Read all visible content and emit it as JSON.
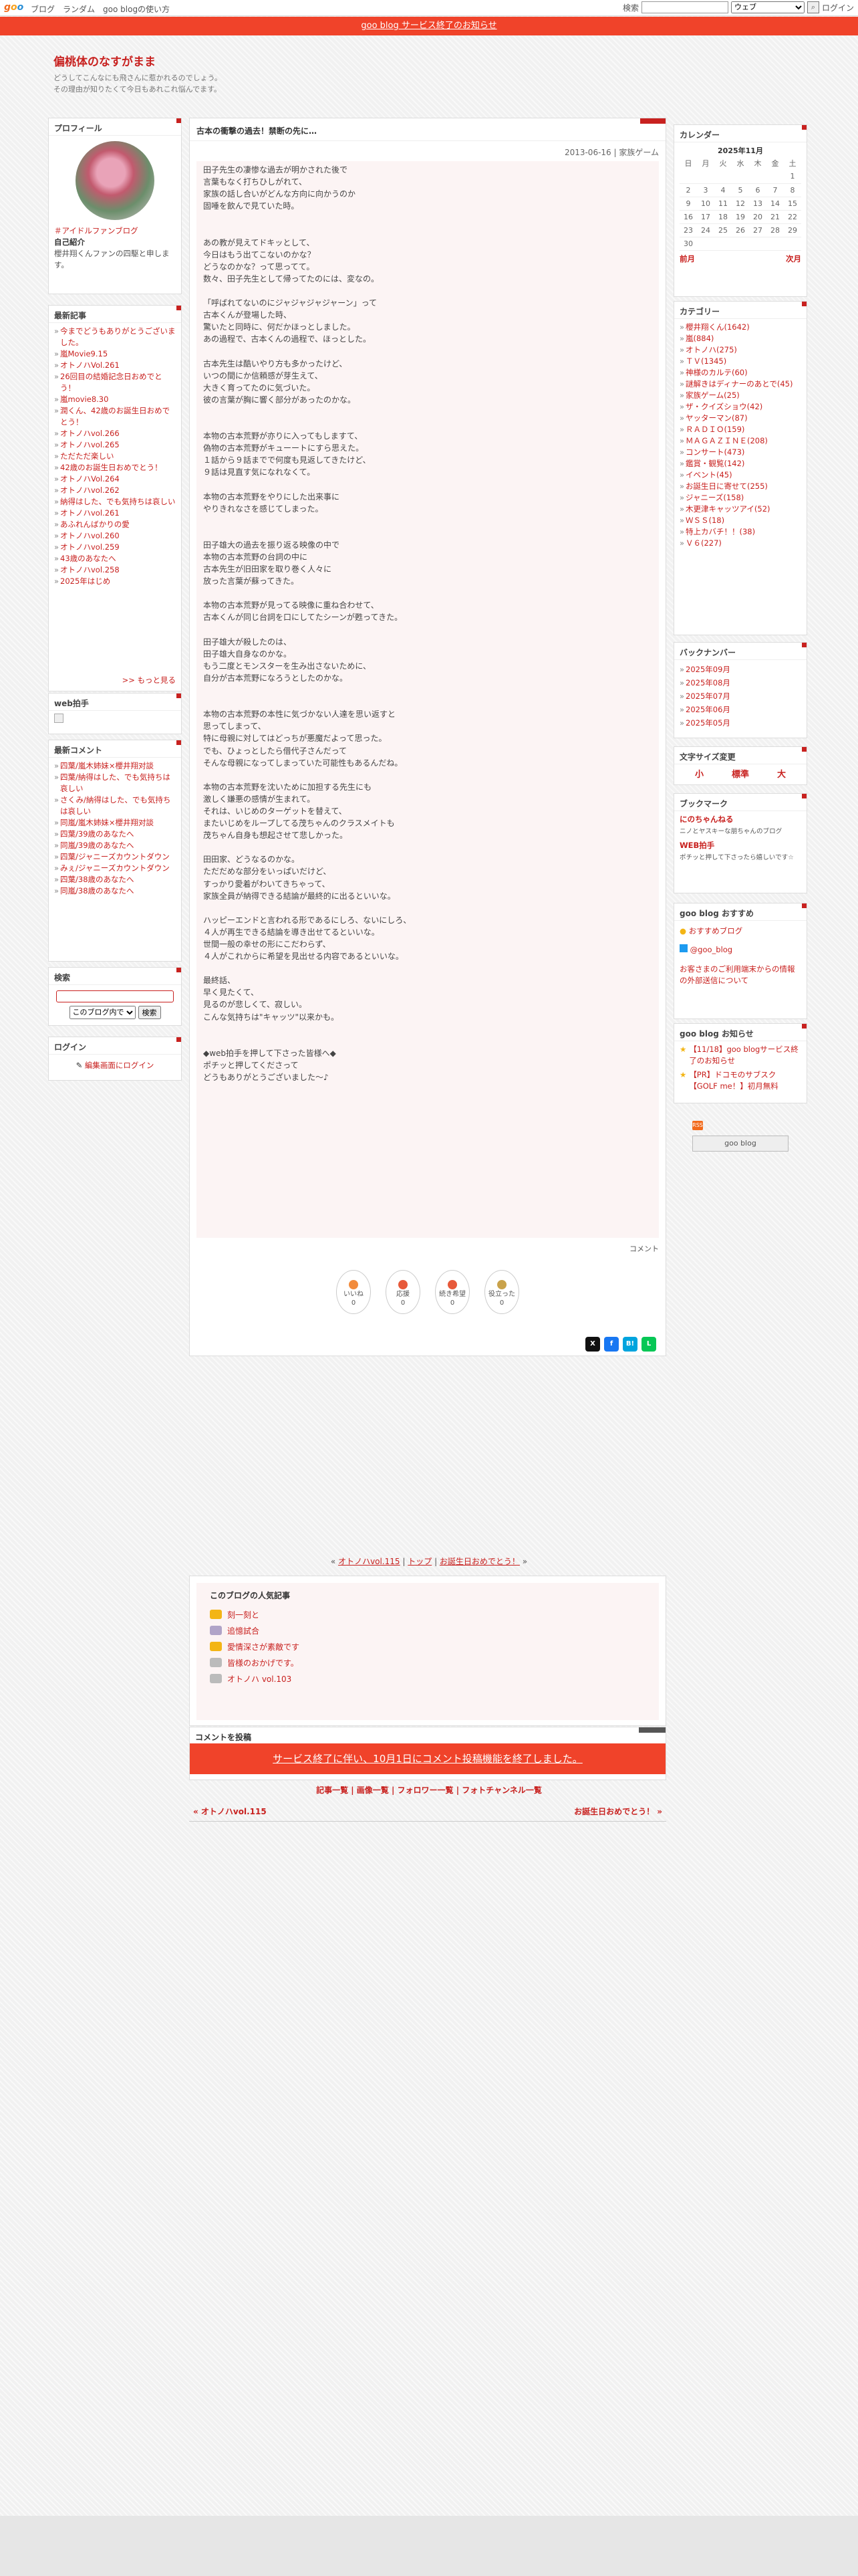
{
  "gbar": {
    "logo": [
      "g",
      "o",
      "o"
    ],
    "links": [
      "ブログ",
      "ランダム",
      "goo blogの使い方"
    ],
    "search_label": "検索",
    "search_select": "ウェブ",
    "login": "ログイン"
  },
  "notice": "goo blog サービス終了のお知らせ",
  "blog": {
    "title": "偏桃体のなすがまま",
    "desc1": "どうしてこんなにも飛さんに惹かれるのでしょう。",
    "desc2": "その理由が知りたくて今日もあれこれ悩んでます。"
  },
  "profile": {
    "heading": "プロフィール",
    "link": "＃アイドルファンブログ",
    "self_label": "自己紹介",
    "self_text": "櫻井翔くんファンの四駆と申します。"
  },
  "recent": {
    "heading": "最新記事",
    "items": [
      "今までどうもありがとうございました。",
      "嵐Movie9.15",
      "オトノハVol.261",
      "26回目の結婚記念日おめでとう！",
      "嵐movie8.30",
      "潤くん、42歳のお誕生日おめでとう！",
      "オトノハvol.266",
      "オトノハvol.265",
      "ただただ楽しい",
      "42歳のお誕生日おめでとう！",
      "オトノハVol.264",
      "オトノハvol.262",
      "納得はした、でも気持ちは哀しい",
      "オトノハvol.261",
      "あふれんばかりの愛",
      "オトノハvol.260",
      "オトノハvol.259",
      "43歳のあなたへ",
      "オトノハvol.258",
      "2025年はじめ"
    ],
    "more": ">> もっと見る"
  },
  "webclap": {
    "heading": "web拍手"
  },
  "comments": {
    "heading": "最新コメント",
    "items": [
      "四葉/嵐木姉妹×櫻井翔对談",
      "四葉/納得はした、でも気持ちは哀しい",
      "さくみ/納得はした、でも気持ちは哀しい",
      "同嵐/嵐木姉妹×櫻井翔对談",
      "四葉/39歳のあなたへ",
      "同嵐/39歳のあなたへ",
      "四葉/ジャニーズカウントダウン",
      "みぇ/ジャニーズカウントダウン",
      "四葉/38歳のあなたへ",
      "同嵐/38歳のあなたへ"
    ]
  },
  "search": {
    "heading": "検索",
    "select": "このブログ内で",
    "button": "検索"
  },
  "login": {
    "heading": "ログイン",
    "link": "編集画面にログイン"
  },
  "article": {
    "title": "古本の衝撃の過去！禁断の先に…",
    "meta": "2013-06-16 | 家族ゲーム",
    "body": "田子先生の凄惨な過去が明かされた後で\n言葉もなく打ちひしがれて、\n家族の話し合いがどんな方向に向かうのか\n固唾を飲んで見ていた時。\n\n\nあの教が見えてドキッとして、\n今日はもう出てこないのかな？\nどうなのかな？って思ってて。\n数々、田子先生として帰ってたのには、変なの。\n\n「呼ばれてないのにジャジャジャジャーン」って\n古本くんが登場した時、\n驚いたと同時に、何だかほっとしました。\nあの過程で、古本くんの過程で、ほっとした。\n\n古本先生は酷いやり方も多かったけど、\nいつの間にか信頼感が芽生えて、\n大きく育ってたのに気づいた。\n彼の言葉が胸に響く部分があったのかな。\n\n\n本物の古本荒野が亦りに入ってもしますて、\n偽物の古本荒野がキューートにすら思えた。\n１話から９話までで何度も見返してきたけど、\n９話は見直す気になれなくて。\n\n本物の古本荒野をやりにした出来事に\nやりきれなさを感じてしまった。\n\n\n田子雄大の過去を振り返る映像の中で\n本物の古本荒野の台詞の中に\n古本先生が旧田家を取り巻く人々に\n放った言葉が蘇ってきた。\n\n本物の古本荒野が見ってる映像に重ね合わせて、\n古本くんが同じ台詞を口にしてたシーンが甦ってきた。\n\n田子雄大が殺したのは、\n田子雄大自身なのかな。\nもう二度とモンスターを生み出さないために、\n自分が古本荒野になろうとしたのかな。\n\n\n本物の古本荒野の本性に気づかない人達を思い返すと\n思ってしまって、\n特に母親に対してはどっちが悪魔だよって思った。\nでも、ひょっとしたら借代子さんだって\nそんな母親になってしまっていた可能性もあるんだね。\n\n本物の古本荒野を沈いために加担する先生にも\n激しく嫌悪の感情が生まれて。\nそれは、いじめのターゲットを替えて、\nまたいじめをループしてる茂ちゃんのクラスメイトも\n茂ちゃん自身も想起させて悲しかった。\n\n田田家、どうなるのかな。\nただだめな部分をいっぱいだけど、\nすっかり愛着がわいてきちゃって、\n家族全員が納得できる結論が最終的に出るといいな。\n\nハッピーエンドと言われる形であるにしろ、ないにしろ、\n４人が再生できる結論を導き出せてるといいな。\n世間一般の幸せの形にこだわらず、\n４人がこれからに希望を見出せる内容であるといいな。\n\n最終話、\n早く見たくて、\n見るのが悲しくて、寂しい。\nこんな気持ちは\"キャッツ\"以来かも。\n\n\n◆web拍手を押して下さった皆様へ◆\nポチッと押してくださって\nどうもありがとうございました〜♪",
    "comment": "コメント",
    "reactions": [
      {
        "en": "いいね",
        "label": "いいね",
        "count": "0",
        "color": "#f28b3c"
      },
      {
        "en": "応援",
        "label": "応援",
        "count": "0",
        "color": "#e7593a"
      },
      {
        "en": "続き希望",
        "label": "続き希望",
        "count": "0",
        "color": "#e7593a"
      },
      {
        "en": "役立った",
        "label": "役立った",
        "count": "0",
        "color": "#c9a24a"
      }
    ],
    "share": [
      {
        "t": "X",
        "c": "#111"
      },
      {
        "t": "f",
        "c": "#1877f2"
      },
      {
        "t": "B!",
        "c": "#00a4de"
      },
      {
        "t": "L",
        "c": "#06c755"
      }
    ]
  },
  "nav": {
    "prev": "オトノハvol.115",
    "top": "トップ",
    "next": "お誕生日おめでとう！"
  },
  "popular": {
    "heading": "このブログの人気記事",
    "items": [
      {
        "t": "刻一刻と",
        "c": "#f3b515"
      },
      {
        "t": "追憶試合",
        "c": "#b0a4c8"
      },
      {
        "t": "愛情深さが素敵です",
        "c": "#f3b515"
      },
      {
        "t": "皆様のおかげです。",
        "c": "#bbb"
      },
      {
        "t": "オトノハ vol.103",
        "c": "#bbb"
      }
    ]
  },
  "post": {
    "heading": "コメントを投稿",
    "bar": "サービス終了に伴い、10月1日にコメント投稿機能を終了しました。"
  },
  "links3": "記事一覧 | 画像一覧 | フォロワー一覧 | フォトチャンネル一覧",
  "bnav": {
    "prev": "« オトノハvol.115",
    "next": "お誕生日おめでとう！ »"
  },
  "calendar": {
    "heading": "カレンダー",
    "month": "2025年11月",
    "days": [
      "日",
      "月",
      "火",
      "水",
      "木",
      "金",
      "土"
    ],
    "weeks": [
      [
        "",
        "",
        "",
        "",
        "",
        "",
        "1"
      ],
      [
        "2",
        "3",
        "4",
        "5",
        "6",
        "7",
        "8"
      ],
      [
        "9",
        "10",
        "11",
        "12",
        "13",
        "14",
        "15"
      ],
      [
        "16",
        "17",
        "18",
        "19",
        "20",
        "21",
        "22"
      ],
      [
        "23",
        "24",
        "25",
        "26",
        "27",
        "28",
        "29"
      ],
      [
        "30",
        "",
        "",
        "",
        "",
        "",
        ""
      ]
    ],
    "prev": "前月",
    "next": "次月"
  },
  "category": {
    "heading": "カテゴリー",
    "items": [
      "櫻井翔くん(1642)",
      "嵐(884)",
      "オトノハ(275)",
      "ＴＶ(1345)",
      "神様のカルテ(60)",
      "謎解きはディナーのあとで(45)",
      "家族ゲーム(25)",
      "ザ・クイズショウ(42)",
      "ヤッターマン(87)",
      "ＲＡＤＩＯ(159)",
      "ＭＡＧＡＺＩＮＥ(208)",
      "コンサート(473)",
      "鑑賞・観覧(142)",
      "イベント(45)",
      "お誕生日に寄せて(255)",
      "ジャニーズ(158)",
      "木更津キャッツアイ(52)",
      "ＷＳＳ(18)",
      "特上カバチ！！(38)",
      "Ｖ６(227)"
    ]
  },
  "backnumber": {
    "heading": "バックナンバー",
    "items": [
      "2025年09月",
      "2025年08月",
      "2025年07月",
      "2025年06月",
      "2025年05月"
    ]
  },
  "fontsize": {
    "heading": "文字サイズ変更",
    "items": [
      "小",
      "標準",
      "大"
    ]
  },
  "bookmark": {
    "heading": "ブックマーク",
    "items": [
      {
        "t": "にのちゃんねる",
        "d": "ニノとヤスキーな朋ちゃんのブログ"
      },
      {
        "t": "WEB拍手",
        "d": "ポチッと押して下さったら嬉しいです☆"
      }
    ]
  },
  "recommend": {
    "heading": "goo blog おすすめ",
    "items": [
      "おすすめブログ",
      "@goo_blog"
    ],
    "note": "お客さまのご利用端末からの情報の外部送信について"
  },
  "news": {
    "heading": "goo blog お知らせ",
    "items": [
      "【11/18】goo blogサービス終了のお知らせ",
      "【PR】ドコモのサブスク【GOLF me！】初月無料"
    ]
  },
  "rss": "RSS",
  "badge": "goo blog"
}
